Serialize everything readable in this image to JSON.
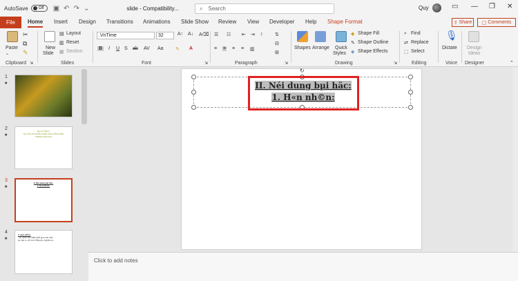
{
  "titlebar": {
    "autosave_label": "AutoSave",
    "autosave_state": "Off",
    "doc_title": "slide - Compatibility...",
    "search_placeholder": "Search",
    "user_name": "Quy"
  },
  "tabs": [
    "File",
    "Home",
    "Insert",
    "Design",
    "Transitions",
    "Animations",
    "Slide Show",
    "Review",
    "View",
    "Developer",
    "Help",
    "Shape Format"
  ],
  "active_tab": "Home",
  "share_label": "Share",
  "comments_label": "Comments",
  "ribbon": {
    "clipboard": {
      "paste": "Paste",
      "label": "Clipboard"
    },
    "slides": {
      "new_slide_1": "New",
      "new_slide_2": "Slide",
      "layout": "Layout",
      "reset": "Reset",
      "section": "Section",
      "label": "Slides"
    },
    "font": {
      "font_name": ".VnTime",
      "font_size": "32",
      "label": "Font"
    },
    "paragraph": {
      "label": "Paragraph"
    },
    "drawing": {
      "shapes": "Shapes",
      "arrange": "Arrange",
      "quick_styles_1": "Quick",
      "quick_styles_2": "Styles",
      "shape_fill": "Shape Fill",
      "shape_outline": "Shape Outline",
      "shape_effects": "Shape Effects",
      "label": "Drawing"
    },
    "editing": {
      "find": "Find",
      "replace": "Replace",
      "select": "Select",
      "label": "Editing"
    },
    "voice": {
      "dictate": "Dictate",
      "label": "Voice"
    },
    "designer": {
      "design_ideas_1": "Design",
      "design_ideas_2": "Ideas",
      "label": "Designer"
    }
  },
  "thumbnails": [
    {
      "num": "1"
    },
    {
      "num": "2",
      "line1": "Bµi 12 TiÕt 3",
      "line2": "QUYÒN VÒ NHÂN THÂN CÑA CÔNG DÂN",
      "line3": "TRONG NHµ N¦íC"
    },
    {
      "num": "3",
      "line1": "II. Néi dung bµi häc:",
      "line2": "1. H«n nh©n:"
    },
    {
      "num": "4",
      "line1": "1. H«n nh©n:",
      "line2": "- Lµ qu©n hÖ ®Æc biÖt gi÷a mét nam",
      "line3": "vµ mét n÷ vÒ t×nh ®ång tõ, nghÜa vô..."
    }
  ],
  "slide": {
    "line1": "II. Néi dung bµi häc:",
    "line2": "1. H«n nh©n:"
  },
  "notes_placeholder": "Click to add notes",
  "colors": {
    "accent": "#c43e1c",
    "highlight_box": "#e02020"
  }
}
